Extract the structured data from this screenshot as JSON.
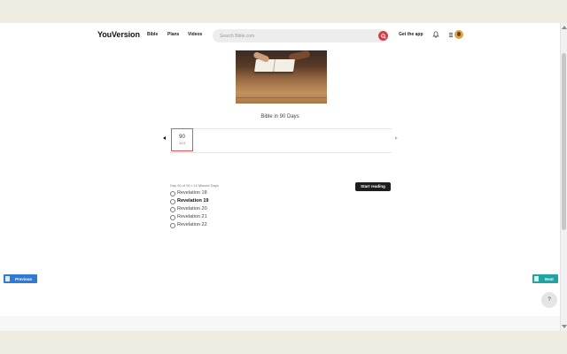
{
  "header": {
    "logo": "YouVersion",
    "nav": [
      "Bible",
      "Plans",
      "Videos"
    ],
    "search_placeholder": "Search Bible.com",
    "get_app": "Get the app"
  },
  "plan": {
    "title": "Bible in 90 Days",
    "day": {
      "number": "90",
      "month": "Jul 8"
    },
    "progress": "Day 90 of 90 • 14 Missed Days",
    "start_label": "Start reading",
    "readings": [
      {
        "label": "Revelation 18",
        "active": false
      },
      {
        "label": "Revelation 19",
        "active": true
      },
      {
        "label": "Revelation 20",
        "active": false
      },
      {
        "label": "Revelation 21",
        "active": false
      },
      {
        "label": "Revelation 22",
        "active": false
      }
    ]
  },
  "nav_buttons": {
    "previous": "Previous",
    "next": "Next"
  },
  "help": "?",
  "colors": {
    "accent": "#e63946",
    "previous": "#2f7bd1",
    "next": "#1fa3a3"
  }
}
